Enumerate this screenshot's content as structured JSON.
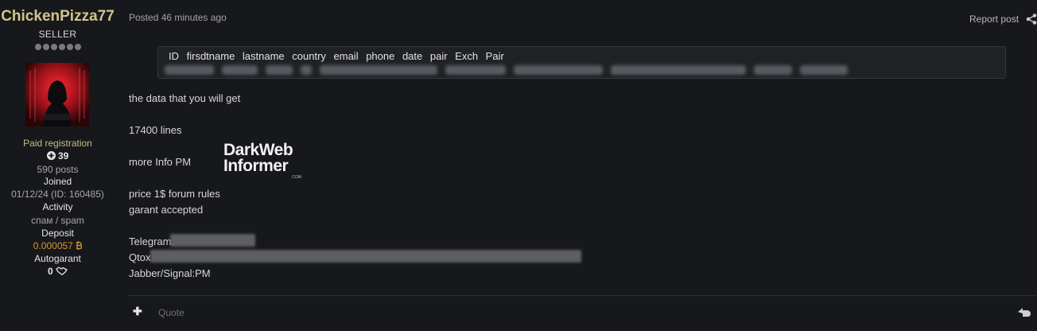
{
  "author": {
    "username": "ChickenPizza77",
    "rank": "SELLER",
    "registration": "Paid registration",
    "reputation": "39",
    "posts": "590 posts",
    "joined_label": "Joined",
    "joined_value": "01/12/24 (ID: 160485)",
    "activity_label": "Activity",
    "activity_value": "спам / spam",
    "deposit_label": "Deposit",
    "deposit_value": "0.000057",
    "autogarant_label": "Autogarant",
    "autogarant_value": "0",
    "colors": {
      "username": "#d3c58a",
      "deposit": "#d69a2a"
    }
  },
  "post": {
    "posted": "Posted 46 minutes ago",
    "report": "Report post",
    "code_header": "ID firsdtname lastname country email phone date pair Exch Pair",
    "lines": [
      "the data that you will get",
      "17400 lines",
      "more Info PM",
      "price 1$ forum rules",
      "garant accepted",
      "Telegram:",
      "Qtox",
      "Jabber/Signal:PM"
    ]
  },
  "watermark": {
    "top": "DarkWeb",
    "bottom": "Informer",
    "suffix": ".COM"
  },
  "footer": {
    "quote": "Quote"
  },
  "icons": [
    "reputation-plus-icon",
    "bitcoin-icon",
    "handshake-icon",
    "share-icon",
    "plus-icon",
    "reply-icon"
  ]
}
